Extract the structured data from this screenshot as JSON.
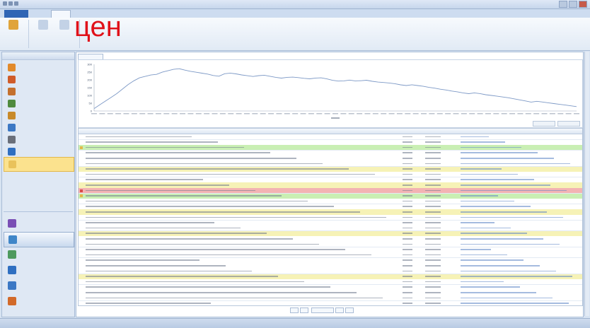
{
  "app": {
    "overlay_text": "цен"
  },
  "ribbon": {
    "file_tab": "",
    "tabs": [
      "",
      ""
    ]
  },
  "chart_data": {
    "type": "line",
    "title": "",
    "ylabel": "",
    "xlabel": "",
    "ylim": [
      0,
      300
    ],
    "y_ticks": [
      0,
      50,
      100,
      150,
      200,
      250,
      300
    ],
    "x_min": 0,
    "x_max": 62000,
    "series": [
      {
        "values": [
          20,
          35,
          60,
          85,
          110,
          140,
          170,
          195,
          215,
          225,
          235,
          240,
          245,
          255,
          265,
          270,
          262,
          255,
          250,
          245,
          240,
          232,
          228,
          235,
          240,
          236,
          230,
          226,
          222,
          228,
          232,
          226,
          220,
          216,
          212,
          214,
          212,
          208,
          206,
          212,
          214,
          208,
          200,
          196,
          198,
          194,
          190,
          192,
          196,
          190,
          186,
          184,
          182,
          178,
          172,
          168,
          164,
          160,
          156,
          150,
          146,
          140,
          136,
          130,
          126,
          120,
          116,
          112,
          108,
          102,
          98,
          94,
          90,
          86,
          80,
          74,
          68,
          62,
          58,
          54,
          50,
          46,
          42,
          38,
          34,
          30
        ]
      }
    ]
  },
  "colors": {
    "green": "#c9efb3",
    "red": "#f3b3b3",
    "yellow": "#f6f2b6",
    "white": "#ffffff",
    "blue": "#e6eef9",
    "line": "#7d99c6"
  },
  "grid_rows": [
    {
      "color": "white"
    },
    {
      "color": "white"
    },
    {
      "color": "green"
    },
    {
      "color": "white"
    },
    {
      "color": "white"
    },
    {
      "color": "white"
    },
    {
      "color": "yellow"
    },
    {
      "color": "white"
    },
    {
      "color": "white"
    },
    {
      "color": "yellow"
    },
    {
      "color": "red"
    },
    {
      "color": "green"
    },
    {
      "color": "white"
    },
    {
      "color": "white"
    },
    {
      "color": "yellow"
    },
    {
      "color": "white"
    },
    {
      "color": "white"
    },
    {
      "color": "white"
    },
    {
      "color": "yellow"
    },
    {
      "color": "white"
    },
    {
      "color": "white"
    },
    {
      "color": "white"
    },
    {
      "color": "white"
    },
    {
      "color": "white"
    },
    {
      "color": "white"
    },
    {
      "color": "white"
    },
    {
      "color": "yellow"
    },
    {
      "color": "white"
    },
    {
      "color": "white"
    },
    {
      "color": "white"
    },
    {
      "color": "white"
    },
    {
      "color": "white"
    }
  ],
  "sidebar": {
    "items": [
      {
        "color": "#e28a2b"
      },
      {
        "color": "#d05c2a"
      },
      {
        "color": "#c4702e"
      },
      {
        "color": "#4f8a3e"
      },
      {
        "color": "#c88a2a"
      },
      {
        "color": "#3c78c4"
      },
      {
        "color": "#6a6f7a"
      },
      {
        "color": "#2f6fc1"
      },
      {
        "color": "#e9c25b"
      }
    ],
    "nav": [
      {
        "color": "#7a4fb5"
      },
      {
        "color": "#3f86c8"
      },
      {
        "color": "#4e9a5e"
      },
      {
        "color": "#2f6fc1"
      },
      {
        "color": "#3c78c4"
      },
      {
        "color": "#d26a2a"
      }
    ]
  }
}
